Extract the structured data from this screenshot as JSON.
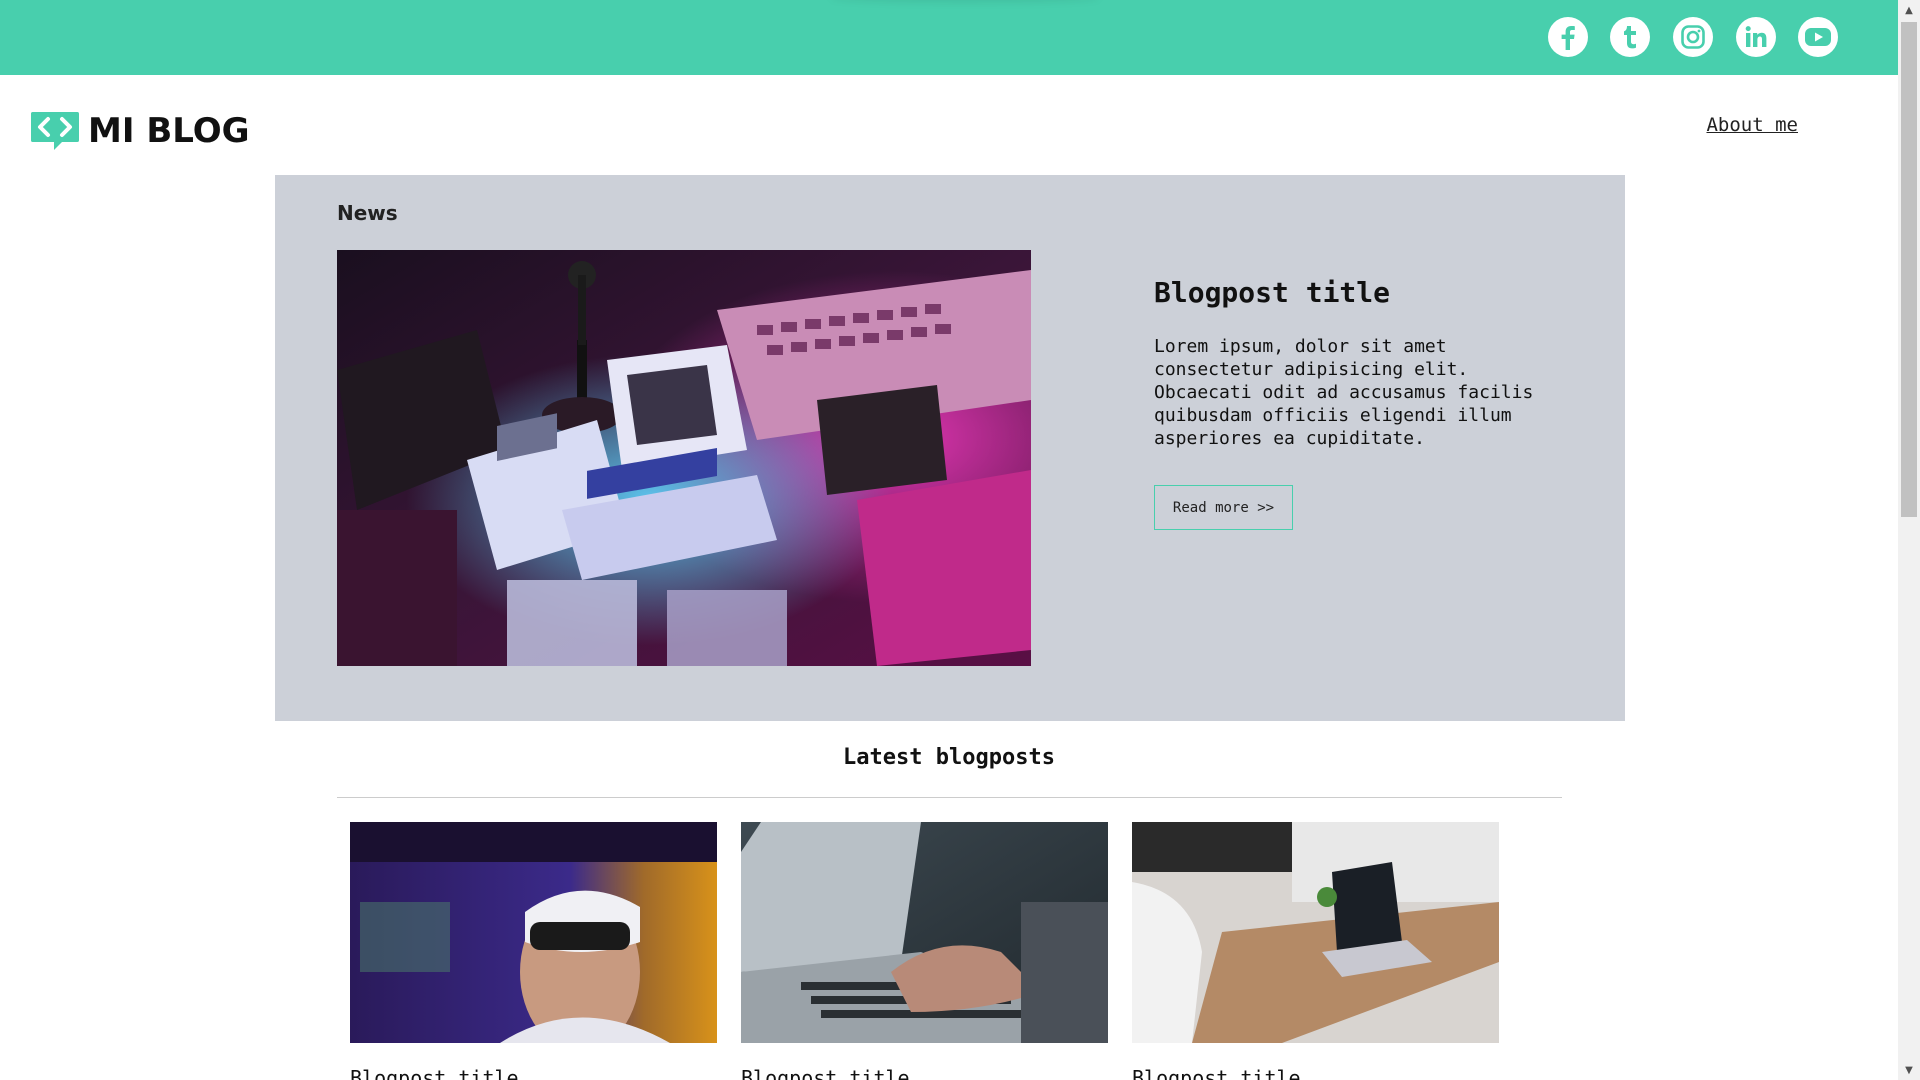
{
  "social": {
    "items": [
      "facebook",
      "tumblr",
      "instagram",
      "linkedin",
      "youtube"
    ]
  },
  "header": {
    "logo_text": "MI BLOG",
    "about_link": "About me"
  },
  "news": {
    "section_label": "News",
    "title": "Blogpost title",
    "excerpt": "Lorem ipsum, dolor sit amet consectetur adipisicing elit. Obcaecati odit ad accusamus facilis quibusdam officiis eligendi illum asperiores ea cupiditate.",
    "read_more": "Read more >>"
  },
  "latest": {
    "heading": "Latest blogposts",
    "cards": [
      {
        "title": "Blogpost title"
      },
      {
        "title": "Blogpost title"
      },
      {
        "title": "Blogpost title"
      }
    ]
  },
  "colors": {
    "accent": "#48cfad",
    "feature_bg": "#ccd0d8"
  }
}
